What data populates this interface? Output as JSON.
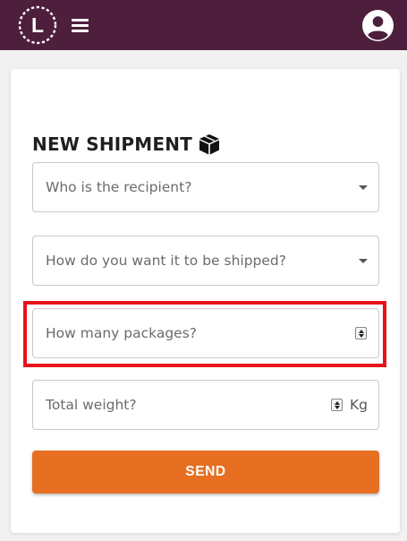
{
  "header": {
    "logo_letter": "L",
    "menu_icon": "hamburger-icon",
    "user_icon": "account-circle-icon",
    "background": "#4d1f3c"
  },
  "form": {
    "title": "NEW SHIPMENT",
    "title_icon": "package-box-icon",
    "recipient": {
      "placeholder": "Who is the recipient?",
      "icon": "dropdown-caret-icon"
    },
    "shipping_method": {
      "placeholder": "How do you want it to be shipped?",
      "icon": "dropdown-caret-icon"
    },
    "packages": {
      "placeholder": "How many packages?",
      "icon": "number-spinner-icon"
    },
    "weight": {
      "placeholder": "Total weight?",
      "unit": "Kg",
      "icon": "number-spinner-icon"
    },
    "send_label": "SEND"
  },
  "colors": {
    "accent": "#e66f22",
    "highlight": "#e8131a"
  }
}
